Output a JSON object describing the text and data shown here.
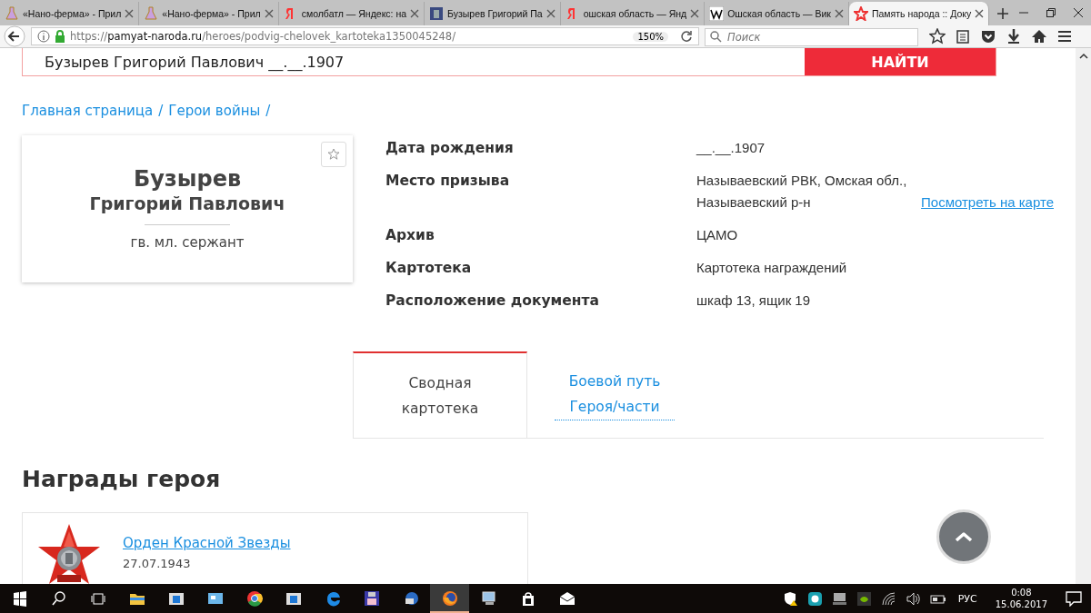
{
  "browser": {
    "tabs": [
      {
        "title": "«Нано-ферма» - Прил",
        "kind": "flask",
        "selected": false
      },
      {
        "title": "«Нано-ферма» - Прил",
        "kind": "flask",
        "selected": false
      },
      {
        "title": "смолбатл — Яндекс: на",
        "kind": "yandex",
        "selected": false
      },
      {
        "title": "Бузырев Григорий Па",
        "selected": false
      },
      {
        "title": "ошская область — Янд",
        "kind": "yandex",
        "selected": false
      },
      {
        "title": "Ошская область — Вик",
        "kind": "wiki",
        "selected": false
      },
      {
        "title": "Память народа :: Доку",
        "kind": "star",
        "selected": true
      }
    ],
    "address": {
      "scheme": "https://",
      "host": "pamyat-naroda.ru",
      "path": "/heroes/podvig-chelovek_kartoteka1350045248/"
    },
    "zoom": "150%",
    "search": {
      "placeholder": "Поиск"
    }
  },
  "page": {
    "search": {
      "value": "Бузырев Григорий Павлович __.__.1907",
      "button": "НАЙТИ"
    },
    "breadcrumbs": {
      "items": [
        "Главная страница",
        "Герои войны"
      ],
      "separator": "/"
    },
    "hero": {
      "surname": "Бузырев",
      "name": "Григорий Павлович",
      "rank": "гв. мл. сержант"
    },
    "details": [
      {
        "label": "Дата рождения",
        "value": "__.__.1907"
      },
      {
        "label": "Место призыва",
        "value": "Называевский РВК, Омская обл., Называевский р-н",
        "link": "Посмотреть на карте"
      },
      {
        "label": "Архив",
        "value": "ЦАМО"
      },
      {
        "label": "Картотека",
        "value": "Картотека награждений"
      },
      {
        "label": "Расположение документа",
        "value": "шкаф 13, ящик 19"
      }
    ],
    "tabs": [
      {
        "label": "Сводная картотека",
        "selected": true
      },
      {
        "label": "Боевой путь Героя/части",
        "selected": false
      }
    ],
    "section_title": "Награды героя",
    "awards": [
      {
        "name": "Орден Красной Звезды",
        "date": "27.07.1943"
      }
    ]
  },
  "taskbar": {
    "lang": "РУС",
    "time": "0:08",
    "date": "15.06.2017"
  }
}
